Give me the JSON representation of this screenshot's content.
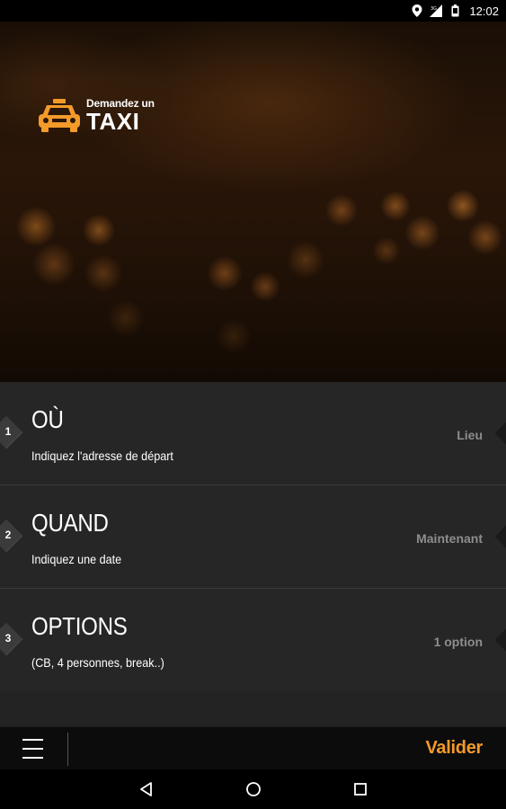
{
  "status_bar": {
    "time": "12:02",
    "icons": [
      "location-icon",
      "signal-icon",
      "battery-icon"
    ]
  },
  "hero": {
    "logo_sub": "Demandez un",
    "logo_main": "TAXI",
    "logo_icon": "taxi-icon",
    "accent_color": "#f39a2a"
  },
  "steps": [
    {
      "number": "1",
      "title": "OÙ",
      "subtitle": "Indiquez l'adresse de départ",
      "value": "Lieu"
    },
    {
      "number": "2",
      "title": "QUAND",
      "subtitle": "Indiquez une date",
      "value": "Maintenant"
    },
    {
      "number": "3",
      "title": "OPTIONS",
      "subtitle": "(CB, 4 personnes, break..)",
      "value": "1 option"
    }
  ],
  "action_bar": {
    "menu_icon": "hamburger-menu-icon",
    "validate_label": "Valider"
  },
  "nav_bar": {
    "icons": [
      "back-icon",
      "home-icon",
      "recent-apps-icon"
    ]
  }
}
